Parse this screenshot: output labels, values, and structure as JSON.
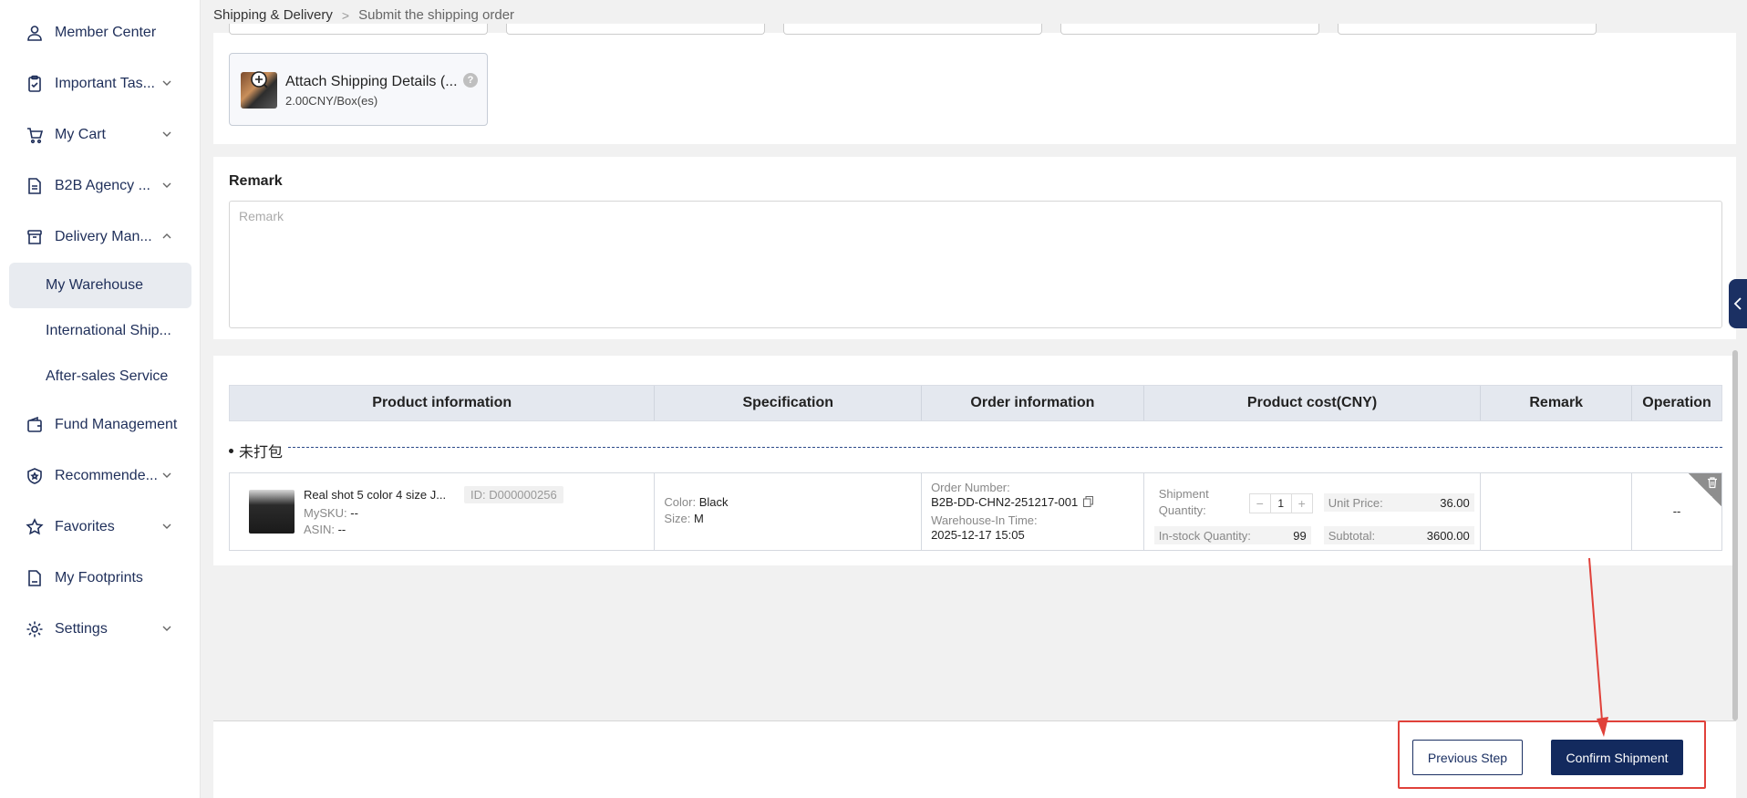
{
  "sidebar": {
    "items": [
      {
        "label": "Member Center",
        "icon": "user-icon",
        "expandable": false
      },
      {
        "label": "Important Tas...",
        "icon": "clipboard-icon",
        "expandable": true
      },
      {
        "label": "My Cart",
        "icon": "cart-icon",
        "expandable": true
      },
      {
        "label": "B2B Agency ...",
        "icon": "document-icon",
        "expandable": true
      },
      {
        "label": "Delivery Man...",
        "icon": "box-icon",
        "expandable": true,
        "expanded": true
      },
      {
        "label": "Fund Management",
        "icon": "wallet-icon",
        "expandable": false
      },
      {
        "label": "Recommende...",
        "icon": "shield-icon",
        "expandable": true
      },
      {
        "label": "Favorites",
        "icon": "star-icon",
        "expandable": true
      },
      {
        "label": "My Footprints",
        "icon": "file-icon",
        "expandable": false
      },
      {
        "label": "Settings",
        "icon": "gear-icon",
        "expandable": true
      }
    ],
    "sub_items": [
      {
        "label": "My Warehouse",
        "active": true
      },
      {
        "label": "International Ship..."
      },
      {
        "label": "After-sales Service"
      }
    ]
  },
  "breadcrumb": {
    "parent": "Shipping & Delivery",
    "separator": ">",
    "current": "Submit the shipping order"
  },
  "attach": {
    "title": "Attach Shipping Details (...",
    "price": "2.00CNY/Box(es)",
    "help": "?"
  },
  "remark": {
    "title": "Remark",
    "placeholder": "Remark"
  },
  "table": {
    "headers": [
      "Product information",
      "Specification",
      "Order information",
      "Product cost(CNY)",
      "Remark",
      "Operation"
    ],
    "group_label": "未打包",
    "rows": [
      {
        "product_name": "Real shot 5 color 4 size J...",
        "product_id": "ID: D000000256",
        "mysku_label": "MySKU:",
        "mysku": "--",
        "asin_label": "ASIN:",
        "asin": "--",
        "color_label": "Color:",
        "color": "Black",
        "size_label": "Size:",
        "size": "M",
        "order_number_label": "Order Number:",
        "order_number": "B2B-DD-CHN2-251217-001",
        "warehouse_in_label": "Warehouse-In Time:",
        "warehouse_in_time": "2025-12-17 15:05",
        "shipment_qty_label": "Shipment Quantity:",
        "shipment_qty": "1",
        "minus": "−",
        "plus": "+",
        "unit_price_label": "Unit Price:",
        "unit_price": "36.00",
        "instock_label": "In-stock Quantity:",
        "instock_qty": "99",
        "subtotal_label": "Subtotal:",
        "subtotal": "3600.00",
        "remark": "",
        "operation": "--"
      }
    ]
  },
  "footer": {
    "prev_label": "Previous Step",
    "confirm_label": "Confirm Shipment"
  },
  "colors": {
    "primary": "#132a5e",
    "highlight": "#e0413a",
    "nav_text": "#1f2f5a"
  }
}
